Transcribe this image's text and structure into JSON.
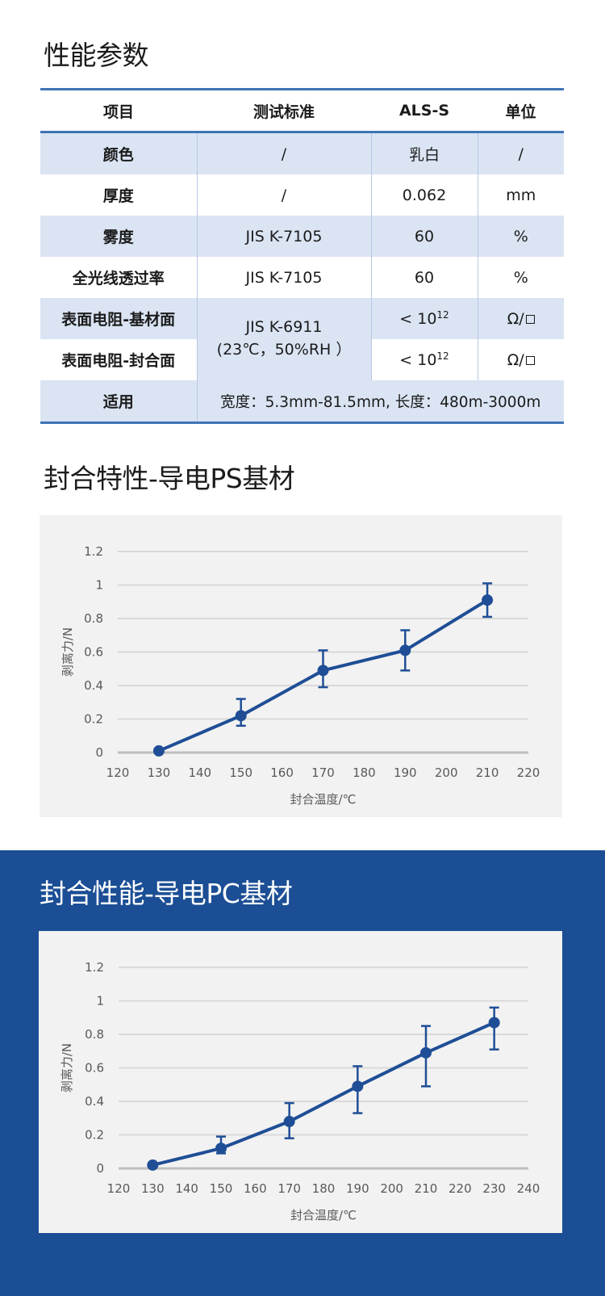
{
  "titles": {
    "params": "性能参数",
    "ps": "封合特性-导电PS基材",
    "pc": "封合性能-导电PC基材"
  },
  "table": {
    "headers": [
      "项目",
      "测试标准",
      "ALS-S",
      "单位"
    ],
    "rows": [
      {
        "item": "颜色",
        "standard": "/",
        "value": "乳白",
        "unit": "/"
      },
      {
        "item": "厚度",
        "standard": "/",
        "value": "0.062",
        "unit": "mm"
      },
      {
        "item": "雾度",
        "standard": "JIS K-7105",
        "value": "60",
        "unit": "%"
      },
      {
        "item": "全光线透过率",
        "standard": "JIS K-7105",
        "value": "60",
        "unit": "%"
      },
      {
        "item": "表面电阻-基材面",
        "standard_line1": "JIS K-6911",
        "standard_line2": "(23℃，50%RH ）",
        "value_prefix": "< 10",
        "value_exp": "12",
        "unit": "Ω/"
      },
      {
        "item": "表面电阻-封合面",
        "value_prefix": "< 10",
        "value_exp": "12",
        "unit": "Ω/"
      },
      {
        "item": "适用",
        "note": "宽度：5.3mm-81.5mm, 长度：480m-3000m"
      }
    ]
  },
  "chart_data": [
    {
      "type": "line",
      "title": "封合特性-导电PS基材",
      "xlabel": "封合温度/℃",
      "ylabel": "剥离力/N",
      "xlim": [
        120,
        220
      ],
      "ylim": [
        0,
        1.2
      ],
      "xticks": [
        "120",
        "130",
        "140",
        "150",
        "160",
        "170",
        "180",
        "190",
        "200",
        "210",
        "220"
      ],
      "yticks": [
        "0",
        "0.2",
        "0.4",
        "0.6",
        "0.8",
        "1",
        "1.2"
      ],
      "x": [
        130,
        150,
        170,
        190,
        210
      ],
      "y": [
        0.01,
        0.22,
        0.49,
        0.61,
        0.91
      ],
      "err_low": [
        0.0,
        0.16,
        0.39,
        0.49,
        0.81
      ],
      "err_high": [
        0.02,
        0.32,
        0.61,
        0.73,
        1.01
      ],
      "color": "#1f4e96",
      "grid": true
    },
    {
      "type": "line",
      "title": "封合性能-导电PC基材",
      "xlabel": "封合温度/℃",
      "ylabel": "剥离力/N",
      "xlim": [
        120,
        240
      ],
      "ylim": [
        0,
        1.2
      ],
      "xticks": [
        "120",
        "130",
        "140",
        "150",
        "160",
        "170",
        "180",
        "190",
        "200",
        "210",
        "220",
        "230",
        "240"
      ],
      "yticks": [
        "0",
        "0.2",
        "0.4",
        "0.6",
        "0.8",
        "1",
        "1.2"
      ],
      "x": [
        130,
        150,
        170,
        190,
        210,
        230
      ],
      "y": [
        0.02,
        0.12,
        0.28,
        0.49,
        0.69,
        0.87
      ],
      "err_low": [
        0.01,
        0.09,
        0.18,
        0.33,
        0.49,
        0.71
      ],
      "err_high": [
        0.03,
        0.19,
        0.39,
        0.61,
        0.85,
        0.96
      ],
      "color": "#1f4e96",
      "grid": true
    }
  ],
  "colors": {
    "accent": "#3f74b6",
    "band": "#1b4e95",
    "row_shade": "#dae4f3",
    "line": "#1f4e96"
  }
}
